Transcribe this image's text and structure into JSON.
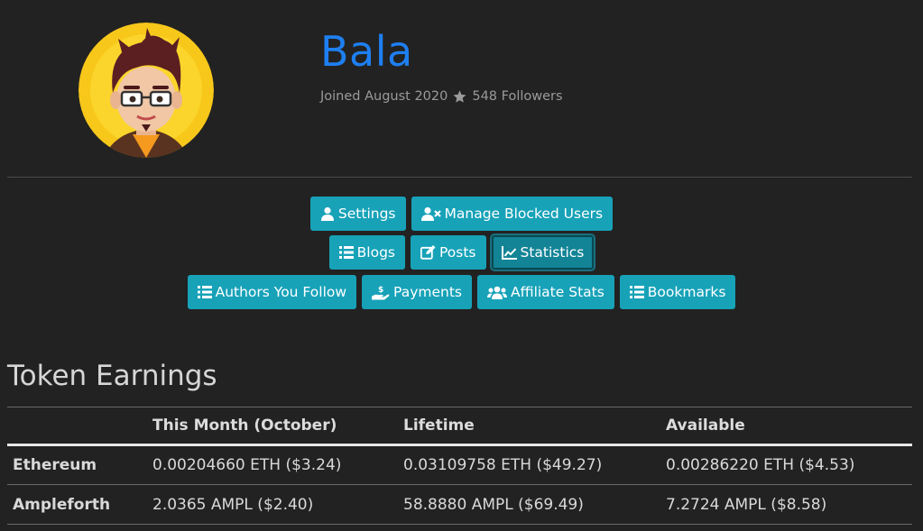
{
  "profile": {
    "name": "Bala",
    "joined": "Joined August 2020",
    "followers": "548 Followers"
  },
  "colors": {
    "accent": "#1e7ff0",
    "button": "#17a2b8",
    "button_active": "#138496",
    "background": "#222222"
  },
  "buttons": {
    "row1": [
      {
        "label": "Settings",
        "icon": "user-icon"
      },
      {
        "label": "Manage Blocked Users",
        "icon": "user-block-icon"
      }
    ],
    "row2": [
      {
        "label": "Blogs",
        "icon": "list-icon"
      },
      {
        "label": "Posts",
        "icon": "edit-icon"
      },
      {
        "label": "Statistics",
        "icon": "chart-line-icon",
        "active": true
      }
    ],
    "row3": [
      {
        "label": "Authors You Follow",
        "icon": "list-icon"
      },
      {
        "label": "Payments",
        "icon": "hand-money-icon"
      },
      {
        "label": "Affiliate Stats",
        "icon": "users-icon"
      },
      {
        "label": "Bookmarks",
        "icon": "list-icon"
      }
    ]
  },
  "earnings": {
    "title": "Token Earnings",
    "headers": [
      "",
      "This Month (October)",
      "Lifetime",
      "Available"
    ],
    "rows": [
      [
        "Ethereum",
        "0.00204660 ETH ($3.24)",
        "0.03109758 ETH ($49.27)",
        "0.00286220 ETH ($4.53)"
      ],
      [
        "Ampleforth",
        "2.0365 AMPL ($2.40)",
        "58.8880 AMPL ($69.49)",
        "7.2724 AMPL ($8.58)"
      ]
    ]
  }
}
